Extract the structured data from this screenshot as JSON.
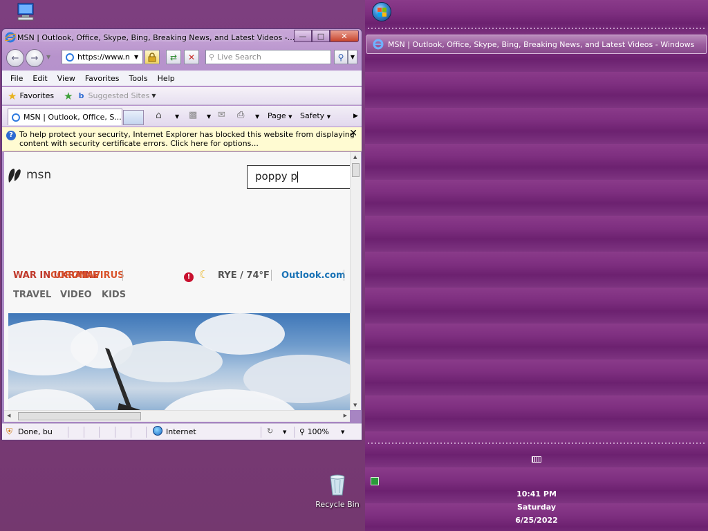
{
  "desktop": {
    "recycle_bin_label": "Recycle Bin"
  },
  "ie": {
    "window_title": "MSN | Outlook, Office, Skype, Bing, Breaking News, and Latest Videos -...",
    "address": "https://www.n",
    "search_placeholder": "Live Search",
    "menu": [
      "File",
      "Edit",
      "View",
      "Favorites",
      "Tools",
      "Help"
    ],
    "favorites_label": "Favorites",
    "suggested_sites_label": "Suggested Sites",
    "tab_title": "MSN | Outlook, Office, S...",
    "page_label": "Page",
    "safety_label": "Safety",
    "infobar_line1": "To help protect your security, Internet Explorer has blocked this website from displaying",
    "infobar_line2": "content with security certificate errors. Click here for options...",
    "status_text": "Done, bu",
    "zone_text": "Internet",
    "zoom": "100%"
  },
  "msn": {
    "logo_text": "msn",
    "search_value": "poppy p",
    "nav_overlap_a": "WAR IN UKRAINE",
    "nav_overlap_b": "CORONAVIRUS",
    "weather": "RYE / 74°F",
    "outlook_link": "Outlook.com",
    "nav2": [
      "TRAVEL",
      "VIDEO",
      "KIDS"
    ]
  },
  "taskbar": {
    "task_title": "MSN | Outlook, Office, Skype, Bing, Breaking News, and Latest Videos - Windows",
    "time": "10:41 PM",
    "day": "Saturday",
    "date": "6/25/2022"
  }
}
